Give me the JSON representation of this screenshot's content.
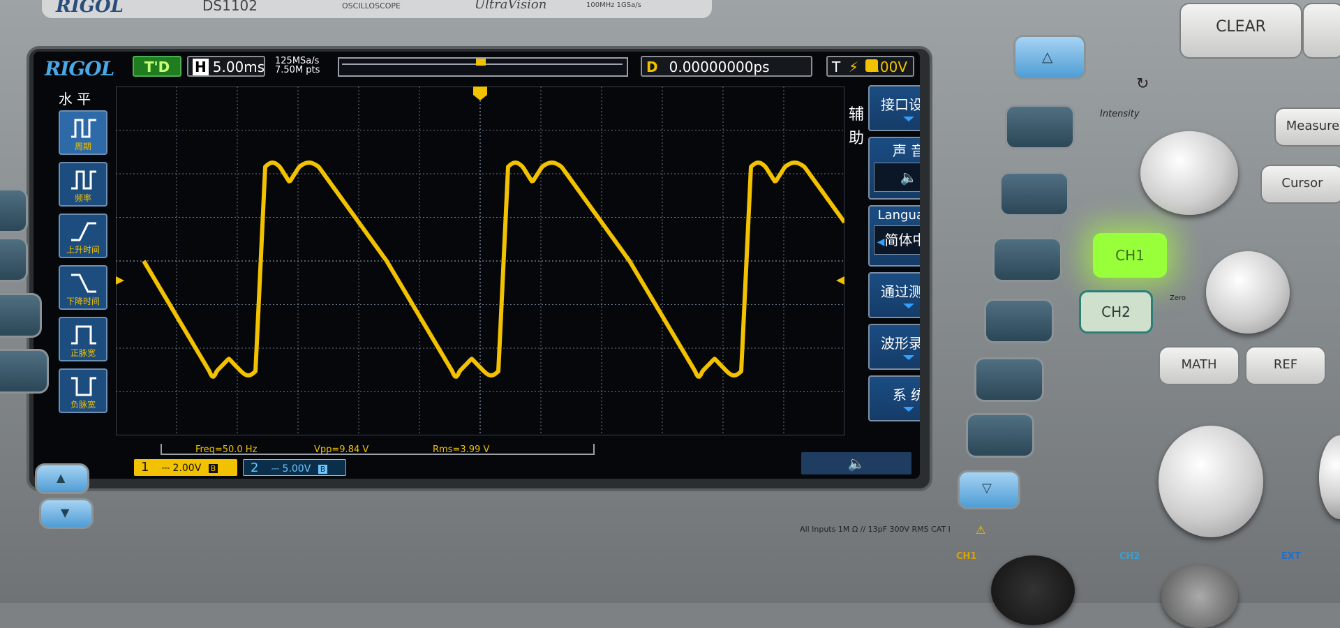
{
  "device": {
    "brand": "RIGOL",
    "top_strip": {
      "model": "DS1102",
      "subtitle": "OSCILLOSCOPE",
      "series": "UltraVision",
      "specs": "100MHz  1GSa/s"
    },
    "inputs_label": "All Inputs 1M Ω // 13pF 300V RMS CAT I"
  },
  "status_bar": {
    "logo": "RIGOL",
    "run_state": "T'D",
    "timebase_label": "H",
    "timebase_value": "5.00ms",
    "sample_rate": "125MSa/s",
    "mem_depth": "7.50M pts",
    "delay_label": "D",
    "delay_value": "0.00000000ps",
    "trigger_label": "T",
    "trigger_level": "0.00V"
  },
  "left_menu": {
    "title": "水 平",
    "items": [
      {
        "label": "周期",
        "icon": "period-icon"
      },
      {
        "label": "频率",
        "icon": "frequency-icon"
      },
      {
        "label": "上升时间",
        "icon": "rise-time-icon"
      },
      {
        "label": "下降时间",
        "icon": "fall-time-icon"
      },
      {
        "label": "正脉宽",
        "icon": "positive-width-icon"
      },
      {
        "label": "负脉宽",
        "icon": "negative-width-icon"
      }
    ]
  },
  "right_menu": {
    "side_title": "辅助",
    "items": [
      {
        "label": "接口设置"
      },
      {
        "label": "声 音",
        "sub": "speaker-muted"
      },
      {
        "label": "Language",
        "sub": "简体中文"
      },
      {
        "label": "通过测试"
      },
      {
        "label": "波形录制"
      },
      {
        "label": "系 统"
      }
    ]
  },
  "measurements": {
    "freq": "Freq=50.0 Hz",
    "vpp": "Vpp=9.84 V",
    "rms": "Rms=3.99 V"
  },
  "channels": {
    "ch1": {
      "num": "1",
      "scale": "2.00V",
      "color": "#f2c200"
    },
    "ch2": {
      "num": "2",
      "scale": "5.00V",
      "color": "#6ec6ff"
    }
  },
  "panel": {
    "clear": "CLEAR",
    "intensity": "Intensity",
    "measure": "Measure",
    "cursor": "Cursor",
    "ch1": "CH1",
    "ch2": "CH2",
    "math": "MATH",
    "ref": "REF",
    "zero": "Zero",
    "connector_ch1": "CH1",
    "connector_ch2": "CH2",
    "connector_ext": "EXT"
  },
  "colors": {
    "trace": "#f2c200",
    "grid": "#6c7a8c",
    "menu_blue": "#1d4d7e",
    "ch1_lit": "#98ff3b"
  }
}
